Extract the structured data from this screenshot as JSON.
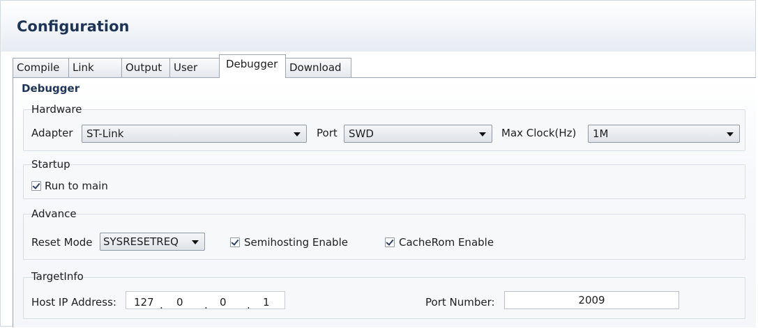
{
  "title": "Configuration",
  "tabs": [
    {
      "label": "Compile"
    },
    {
      "label": "Link"
    },
    {
      "label": "Output"
    },
    {
      "label": "User"
    },
    {
      "label": "Debugger",
      "active": true
    },
    {
      "label": "Download"
    }
  ],
  "section_title": "Debugger",
  "hardware": {
    "legend": "Hardware",
    "adapter_label": "Adapter",
    "adapter_value": "ST-Link",
    "port_label": "Port",
    "port_value": "SWD",
    "maxclock_label": "Max Clock(Hz)",
    "maxclock_value": "1M"
  },
  "startup": {
    "legend": "Startup",
    "run_to_main_label": "Run to main",
    "run_to_main_checked": true
  },
  "advance": {
    "legend": "Advance",
    "reset_mode_label": "Reset Mode",
    "reset_mode_value": "SYSRESETREQ",
    "semihosting_label": "Semihosting Enable",
    "semihosting_checked": true,
    "cacherom_label": "CacheRom Enable",
    "cacherom_checked": true
  },
  "targetinfo": {
    "legend": "TargetInfo",
    "host_ip_label": "Host IP Address:",
    "ip": [
      "127",
      "0",
      "0",
      "1"
    ],
    "ip_separator": ".",
    "port_number_label": "Port Number:",
    "port_number_value": "2009"
  },
  "colors": {
    "title": "#1e3457",
    "border": "#9aa6b4",
    "checkmark": "#2b3f5e"
  }
}
